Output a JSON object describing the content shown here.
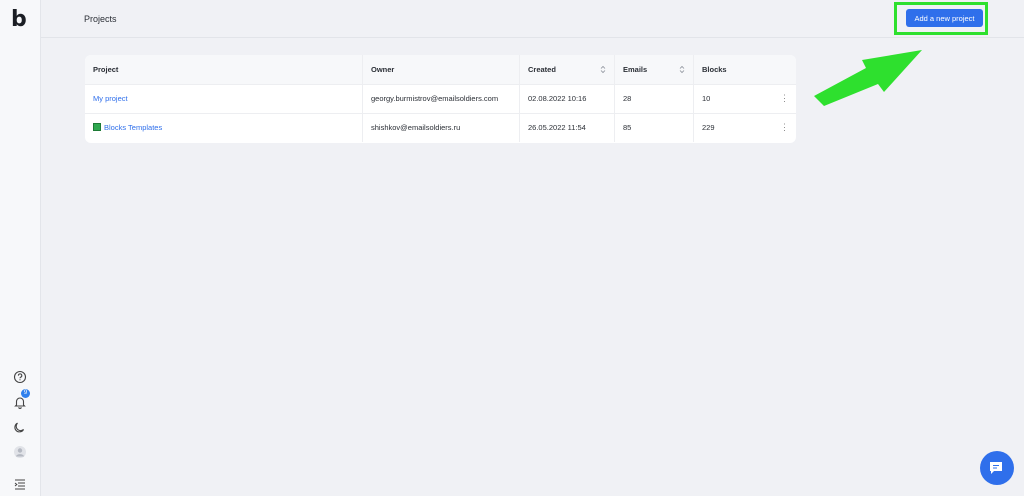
{
  "app": {
    "logo_letter": "b",
    "accent_color": "#2f6feb"
  },
  "sidebar": {
    "icons": [
      "help-circle-icon",
      "bell-icon",
      "moon-icon",
      "avatar-icon",
      "menu-collapse-icon"
    ],
    "notification_count": "9"
  },
  "header": {
    "title": "Projects",
    "add_button_label": "Add a new project"
  },
  "table": {
    "columns": [
      "Project",
      "Owner",
      "Created",
      "Emails",
      "Blocks"
    ],
    "rows": [
      {
        "project": "My project",
        "owner": "georgy.burmistrov@emailsoldiers.com",
        "created": "02.08.2022 10:16",
        "emails": "28",
        "blocks": "10",
        "menu": "⋮"
      },
      {
        "project": "Blocks Templates",
        "owner": "shishkov@emailsoldiers.ru",
        "created": "26.05.2022 11:54",
        "emails": "85",
        "blocks": "229",
        "menu": "⋮"
      }
    ]
  },
  "annotation": {
    "highlight_color": "#2ee02e"
  }
}
